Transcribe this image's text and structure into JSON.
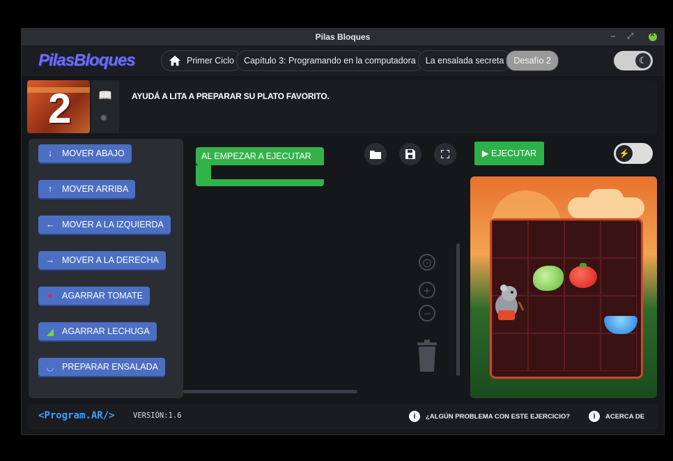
{
  "window": {
    "title": "Pilas Bloques"
  },
  "header": {
    "logo": "PilasBloques",
    "breadcrumbs": [
      {
        "label": "Primer Ciclo"
      },
      {
        "label": "Capítulo 3: Programando en la computadora"
      },
      {
        "label": "La ensalada secreta"
      },
      {
        "label": "Desafío 2"
      }
    ],
    "theme_icon": "moon-icon"
  },
  "challenge": {
    "number": "2",
    "instruction": "AYUDÁ A LITA A PREPARAR SU PLATO FAVORITO."
  },
  "toolbox": {
    "blocks": [
      {
        "label": "MOVER ABAJO",
        "icon": "↓"
      },
      {
        "label": "MOVER ARRIBA",
        "icon": "↑"
      },
      {
        "label": "MOVER A LA IZQUIERDA",
        "icon": "←"
      },
      {
        "label": "MOVER A LA DERECHA",
        "icon": "→"
      },
      {
        "label": "AGARRAR TOMATE",
        "icon": "●"
      },
      {
        "label": "AGARRAR LECHUGA",
        "icon": "◢"
      },
      {
        "label": "PREPARAR ENSALADA",
        "icon": "◡"
      }
    ]
  },
  "workspace": {
    "event_block": "AL EMPEZAR A EJECUTAR",
    "open_icon": "folder-icon",
    "save_icon": "save-icon",
    "fullscreen_icon": "fullscreen-icon",
    "zoom_in": "+",
    "zoom_out": "−"
  },
  "run": {
    "label": "EJECUTAR",
    "turbo_icon": "bolt-icon"
  },
  "footer": {
    "brand": "<Program.AR/>",
    "version": "VERSIÓN:1.6",
    "problem_link": "¿ALGÚN PROBLEMA CON ESTE EJERCICIO?",
    "about_link": "ACERCA DE"
  }
}
